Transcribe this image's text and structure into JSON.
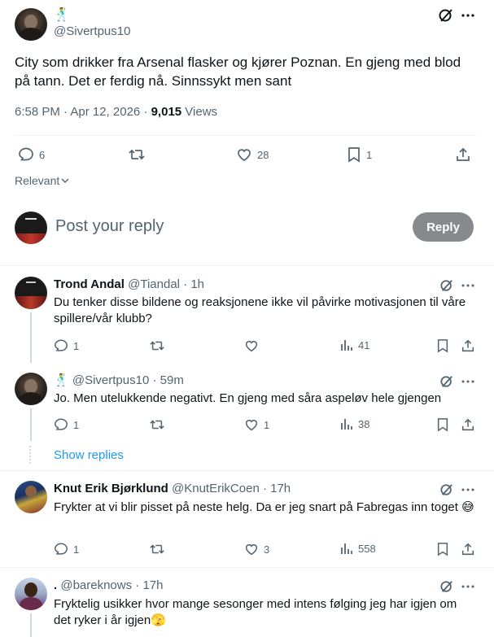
{
  "post": {
    "author_emoji": "🕺",
    "handle": "@Sivertpus10",
    "text": "City som drikker fra Arsenal flasker og kjører Poznan. En gjeng med blod på tann. Det er ferdig nå. Sinnssykt men sant",
    "time": "6:58 PM · Apr 12, 2026 · ",
    "views_count": "9,015",
    "views_label": " Views",
    "replies": "6",
    "retweets": "",
    "likes": "28",
    "bookmarks": "1"
  },
  "sort_label": "Relevant",
  "composer": {
    "placeholder": "Post your reply",
    "button": "Reply"
  },
  "replies": [
    {
      "name": "Trond Andal",
      "handle": "@Tiandal · 1h",
      "text": "Du tenker disse bildene og reaksjonene ikke vil påvirke motivasjonen til våre spillere/vår klubb?",
      "replies": "1",
      "likes": "",
      "views": "41"
    },
    {
      "name": "🕺",
      "handle": "@Sivertpus10 · 59m",
      "text": "Jo. Men utelukkende negativt. En gjeng med såra aspeløv hele gjengen",
      "replies": "1",
      "likes": "1",
      "views": "38"
    },
    {
      "name": "Knut Erik Bjørklund",
      "handle": "@KnutErikCoen · 17h",
      "text": "Frykter at vi blir pisset på neste helg. Da er jeg snart på Fabregas inn toget 😅",
      "replies": "1",
      "likes": "3",
      "views": "558"
    },
    {
      "name": ".",
      "handle": "@bareknows · 17h",
      "text": "Fryktelig usikker hvor mange sesonger med intens følging jeg har igjen om det ryker i år igjen🫣"
    }
  ],
  "show_replies": "Show replies",
  "colors": {
    "accent": "#1d9bf0",
    "reply_button": "#87898c",
    "text": "#0f1419",
    "muted": "#536471"
  }
}
